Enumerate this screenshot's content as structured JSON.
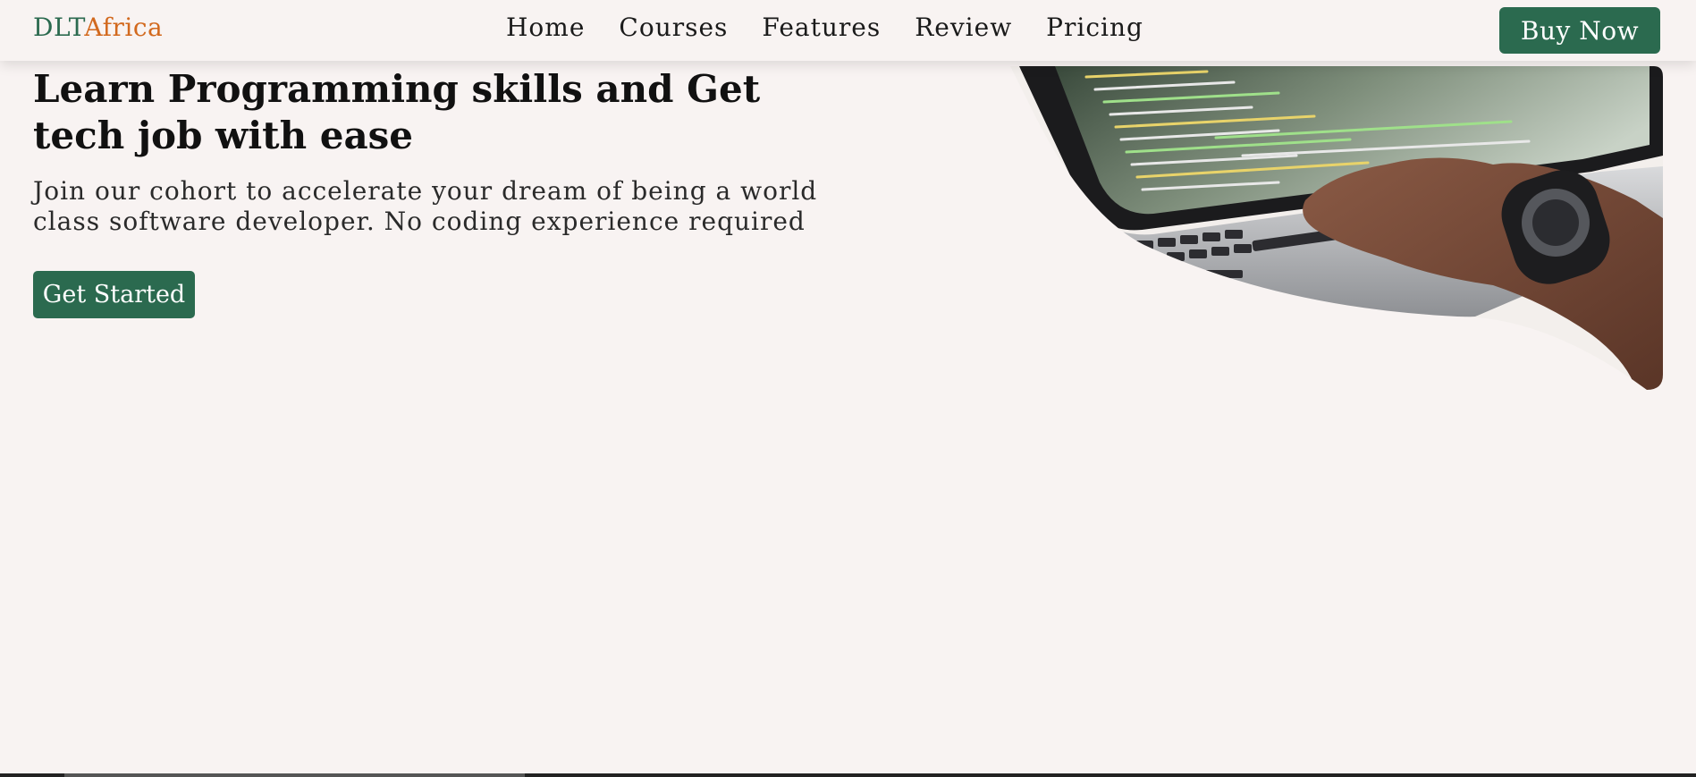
{
  "header": {
    "logo_part1": "DLT",
    "logo_part2": "Africa",
    "nav": {
      "home": "Home",
      "courses": "Courses",
      "features": "Features",
      "review": "Review",
      "pricing": "Pricing"
    },
    "buy_button": "Buy Now"
  },
  "hero": {
    "title": "Learn Programming skills and Get tech job with ease",
    "subtitle": "Join our cohort to accelerate your dream of being a world class software developer. No coding experience required",
    "cta_button": "Get Started",
    "image_icon": "laptop-coding-photo"
  },
  "colors": {
    "brand_green": "#2b6a4f",
    "brand_orange": "#d2691e",
    "background": "#f8f3f2"
  }
}
